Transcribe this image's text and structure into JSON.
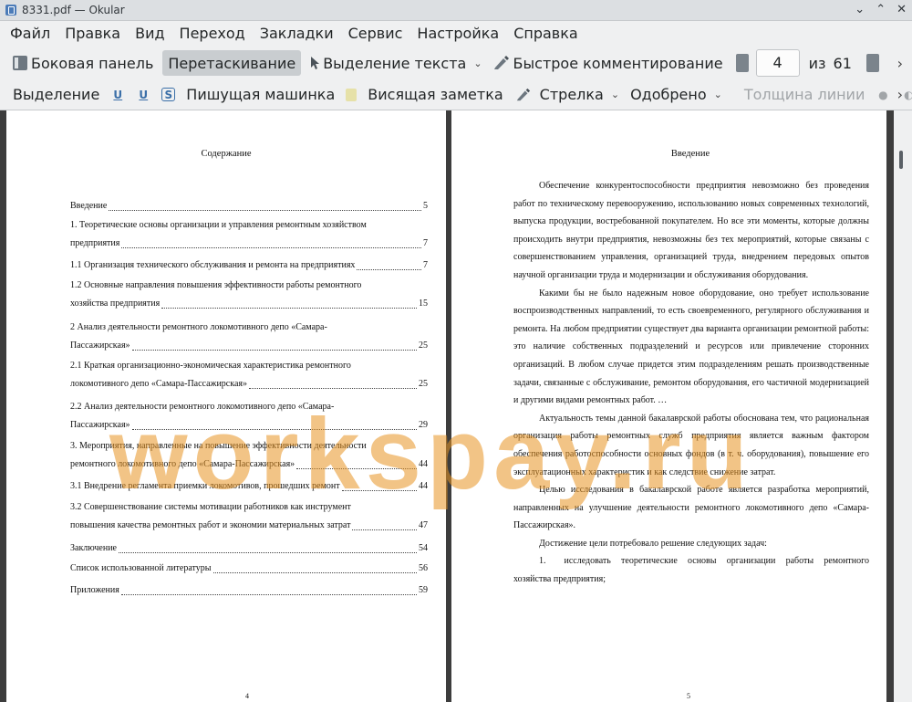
{
  "window": {
    "title": "8331.pdf — Okular",
    "buttons": [
      "⌄",
      "⌃",
      "✕"
    ]
  },
  "menu": [
    "Файл",
    "Правка",
    "Вид",
    "Переход",
    "Закладки",
    "Сервис",
    "Настройка",
    "Справка"
  ],
  "toolbar1": {
    "sidebar": "Боковая панель",
    "drag": "Перетаскивание",
    "text_select": "Выделение текста",
    "quick_annot": "Быстрое комментирование",
    "page_current": "4",
    "page_of": "из",
    "page_total": "61",
    "more": "›"
  },
  "toolbar2": {
    "selection": "Выделение",
    "typewriter": "Пишущая машинка",
    "sticky": "Висящая заметка",
    "arrow": "Стрелка",
    "stamp": "Одобрено",
    "line_width": "Толщина линии",
    "more": "›"
  },
  "watermark": "workspay.ru",
  "left_page": {
    "title": "Содержание",
    "toc": [
      {
        "lines": [],
        "last": "Введение",
        "page": "5"
      },
      {
        "lines": [
          "1. Теоретические основы организации и управления ремонтным хозяйством"
        ],
        "last": "предприятия",
        "page": "7"
      },
      {
        "lines": [],
        "last": "1.1 Организация технического обслуживания и ремонта на предприятиях",
        "page": "7"
      },
      {
        "lines": [
          "1.2 Основные направления повышения эффективности работы ремонтного"
        ],
        "last": "хозяйства предприятия",
        "page": "15"
      },
      {
        "lines": [
          "2 Анализ деятельности ремонтного локомотивного депо «Самара-"
        ],
        "last": "Пассажирская»",
        "page": "25"
      },
      {
        "lines": [
          "2.1 Краткая организационно-экономическая характеристика ремонтного"
        ],
        "last": "локомотивного депо «Самара-Пассажирская»",
        "page": "25"
      },
      {
        "lines": [
          "2.2 Анализ деятельности ремонтного локомотивного депо «Самара-"
        ],
        "last": "Пассажирская»",
        "page": "29"
      },
      {
        "lines": [
          "3. Мероприятия, направленные на повышение эффективности деятельности"
        ],
        "last": "ремонтного локомотивного депо «Самара-Пассажирская»",
        "page": "44"
      },
      {
        "lines": [],
        "last": "3.1 Внедрение регламента приемки локомотивов, прошедших ремонт",
        "page": "44"
      },
      {
        "lines": [
          "3.2 Совершенствование системы мотивации работников как инструмент"
        ],
        "last": "повышения качества ремонтных работ и экономии материальных затрат",
        "page": "47"
      },
      {
        "lines": [],
        "last": "Заключение",
        "page": "54"
      },
      {
        "lines": [],
        "last": "Список использованной литературы",
        "page": "56"
      },
      {
        "lines": [],
        "last": "Приложения",
        "page": "59"
      }
    ],
    "page_number": "4"
  },
  "right_page": {
    "title": "Введение",
    "paragraphs": [
      "Обеспечение конкурентоспособности предприятия невозможно без проведения работ по техническому перевооружению, использованию новых современных технологий, выпуска продукции, востребованной покупателем. Но все эти моменты, которые должны происходить внутри предприятия, невозможны без тех мероприятий, которые связаны с совершенствованием управления, организацией труда, внедрением передовых опытов научной организации труда и модернизации и обслуживания оборудования.",
      "Какими бы не было надежным новое оборудование, оно требует использование воспроизводственных направлений, то есть своевременного, регулярного обслуживания и ремонта. На любом предприятии существует два варианта организации ремонтной работы: это наличие собственных подразделений и ресурсов или привлечение сторонних организаций. В любом случае придется этим подразделениям решать производственные задачи, связанные с обслуживание, ремонтом оборудования, его частичной модернизацией и другими видами ремонтных работ. …",
      "Актуальность темы данной бакалаврской работы обоснована тем, что рациональная организация работы ремонтных служб предприятия является важным фактором обеспечения работоспособности основных фондов (в т. ч. оборудования), повышение его эксплуатационных характеристик и как следствие снижение затрат.",
      "Целью исследования в бакалаврской работе является разработка мероприятий, направленных на улучшение деятельности ремонтного локомотивного депо «Самара-Пассажирская».",
      "Достижение цели потребовало решение следующих задач:",
      "1.  исследовать теоретические основы организации работы ремонтного хозяйства предприятия;"
    ],
    "page_number": "5"
  }
}
